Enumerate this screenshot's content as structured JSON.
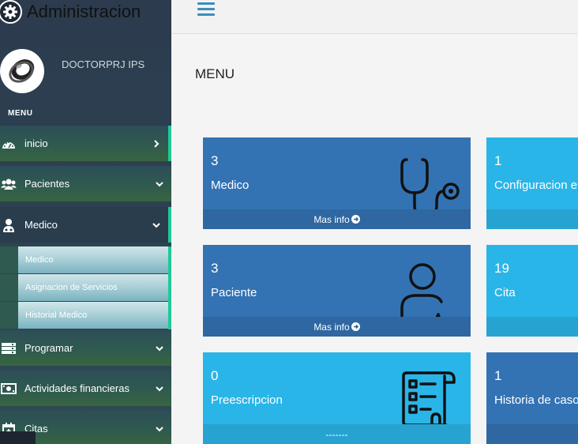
{
  "brand": {
    "title": "Administracion",
    "icon": "gear-icon"
  },
  "user": {
    "name": "DOCTORPRJ IPS",
    "avatar_icon": "ring-avatar"
  },
  "sidebar": {
    "section_label": "MENU",
    "items": [
      {
        "label": "inicio",
        "icon": "dashboard-icon",
        "chevron": "chevron-right-icon"
      },
      {
        "label": "Pacientes",
        "icon": "users-icon",
        "chevron": "chevron-down-icon"
      },
      {
        "label": "Medico",
        "icon": "user-md-icon",
        "chevron": "chevron-down-icon"
      },
      {
        "label": "Programar",
        "icon": "server-icon",
        "chevron": "chevron-down-icon"
      },
      {
        "label": "Actividades financieras",
        "icon": "money-icon",
        "chevron": "chevron-down-icon"
      },
      {
        "label": "Citas",
        "icon": "calendar-plus-icon",
        "chevron": "chevron-down-icon"
      }
    ],
    "sub_items": [
      {
        "label": "Medico"
      },
      {
        "label": "Asignacion de Servicios"
      },
      {
        "label": "Historial Medico"
      }
    ]
  },
  "header": {
    "menu_icon": "hamburger-icon"
  },
  "main": {
    "title": "MENU",
    "cards": [
      {
        "count": "3",
        "label": "Medico",
        "footer": "Mas info",
        "icon": "stethoscope-icon",
        "color": "#3373b3"
      },
      {
        "count": "1",
        "label": "Configuracion e",
        "footer": "",
        "icon": "",
        "color": "#2ab5e8"
      },
      {
        "count": "3",
        "label": "Paciente",
        "footer": "Mas info",
        "icon": "patient-heartbeat-icon",
        "color": "#3373b3"
      },
      {
        "count": "19",
        "label": "Cita",
        "footer": "",
        "icon": "",
        "color": "#2ab5e8"
      },
      {
        "count": "0",
        "label": "Preescripcion",
        "footer": "-------",
        "icon": "prescription-icon",
        "color": "#2ab5e8"
      },
      {
        "count": "1",
        "label": "Historia de caso",
        "footer": "",
        "icon": "",
        "color": "#3373b3"
      }
    ]
  },
  "colors": {
    "accent": "#20c997",
    "primary_blue": "#3373b3",
    "cyan": "#2ab5e8",
    "header_icon": "#3c8dbc"
  }
}
